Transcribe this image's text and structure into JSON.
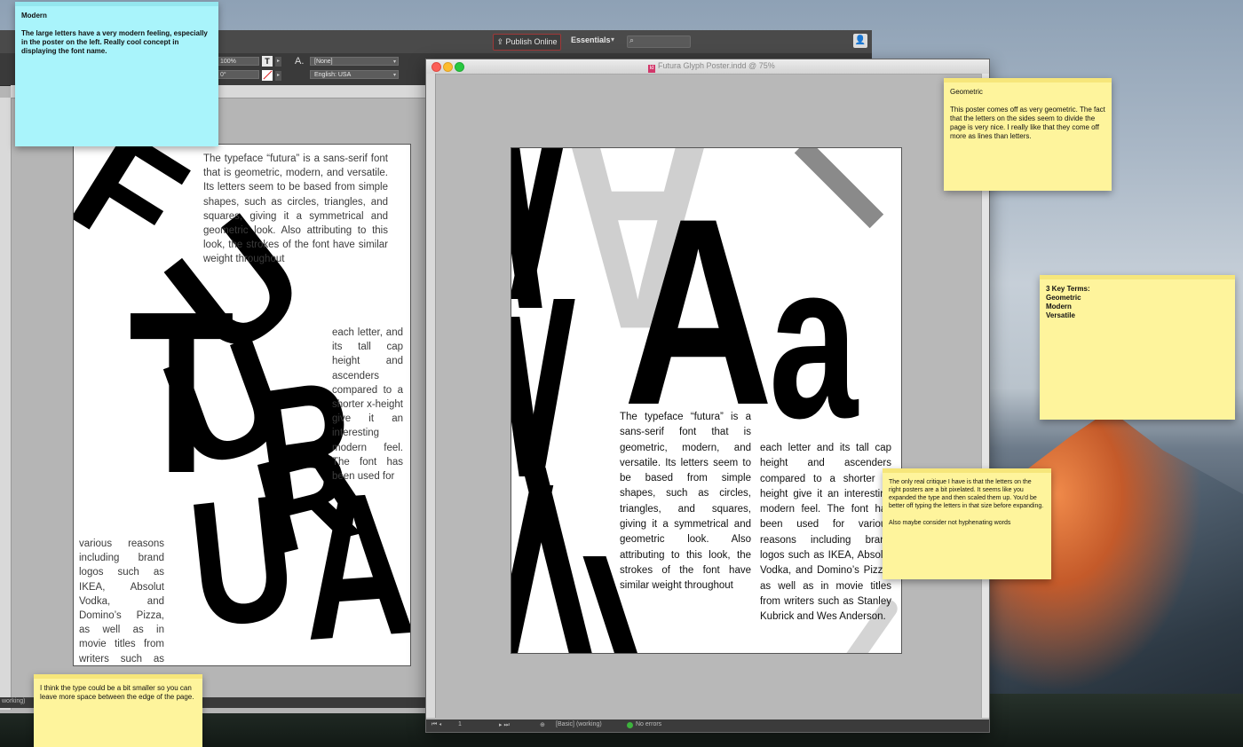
{
  "back_window": {
    "topbar": {
      "publish_label": "Publish Online",
      "workspace_label": "Essentials",
      "workspace_chevron": "▾",
      "search_icon": "magnifier",
      "user_icon": "person"
    },
    "control_bar": {
      "scale_value": "100%",
      "angle_value": "0°",
      "style_value": "[None]",
      "language_value": "English: USA"
    },
    "status_text": "working)"
  },
  "left_poster": {
    "big_letters": [
      "F",
      "U",
      "T",
      "U",
      "R",
      "U",
      "R",
      "A",
      "A"
    ],
    "top_text": "The typeface “futura” is a sans-serif font that is geometric, modern, and versatile. Its letters seem to be based from simple shapes, such as circles, triangles, and squares, giving it a symmetrical and geometric look. Also attributing to this look, the strokes of the font have similar weight throughout",
    "mid_text": "each letter, and its tall cap height and ascenders compared to a shorter x-height give it an interesting modern feel. The font has been used for",
    "bottom_text": "various reasons including brand logos such as IKEA, Absolut Vodka, and Domino’s Pizza, as well as in movie titles from writers such as Stanley Kubrick and Wes Anderson."
  },
  "front_window": {
    "title": "Futura Glyph Poster.indd @ 75%",
    "doc_icon_label": "Id",
    "status": {
      "page": "1",
      "style": "[Basic] (working)",
      "errors": "No errors"
    }
  },
  "right_poster": {
    "glyph_upper": "A",
    "glyph_lower": "a",
    "grey_glyph": "A",
    "left_text": "The typeface “futura” is a sans-serif font that is geometric, modern, and versatile. Its letters seem to be based from simple shapes, such as circles, triangles, and squares, giving it a symmetrical and geometric look. Also attributing to this look, the strokes of the font have similar weight throughout",
    "right_text": "each letter and its tall cap height and ascenders compared to a shorter x-height give it an interesting modern feel. The font has been used for various reasons including brand logos such as IKEA, Absolut Vodka, and Domino’s Pizza, as well as in movie titles from writers such as Stanley Kubrick and Wes Anderson."
  },
  "stickies": {
    "modern": {
      "title": "Modern",
      "body": "The large letters have a very modern feeling, especially in the poster on the left.  Really cool concept in displaying the font name."
    },
    "geometric": {
      "title": "Geometric",
      "body": "This poster comes off as very geometric. The fact that the letters on the sides seem to divide the page is very nice. I really like that they come off more as lines than letters."
    },
    "key_terms": {
      "title": "3 Key Terms:",
      "terms": [
        "Geometric",
        "Modern",
        "Versatile"
      ]
    },
    "critique": {
      "body": "The only real critique I have is that the letters on the right posters are a bit pixelated. It seems like you expanded the type and then scaled them up. You'd be better off typing the letters in that size before expanding.",
      "body2": "Also maybe consider not hyphenating words"
    },
    "smaller": {
      "body": "I think the type could be a bit smaller so you can leave more space between the edge of the page."
    }
  },
  "colors": {
    "sticky_yellow": "#fef49c",
    "sticky_blue": "#a9f4fb",
    "publish_border": "#a03838",
    "status_ok": "#3db33d"
  }
}
